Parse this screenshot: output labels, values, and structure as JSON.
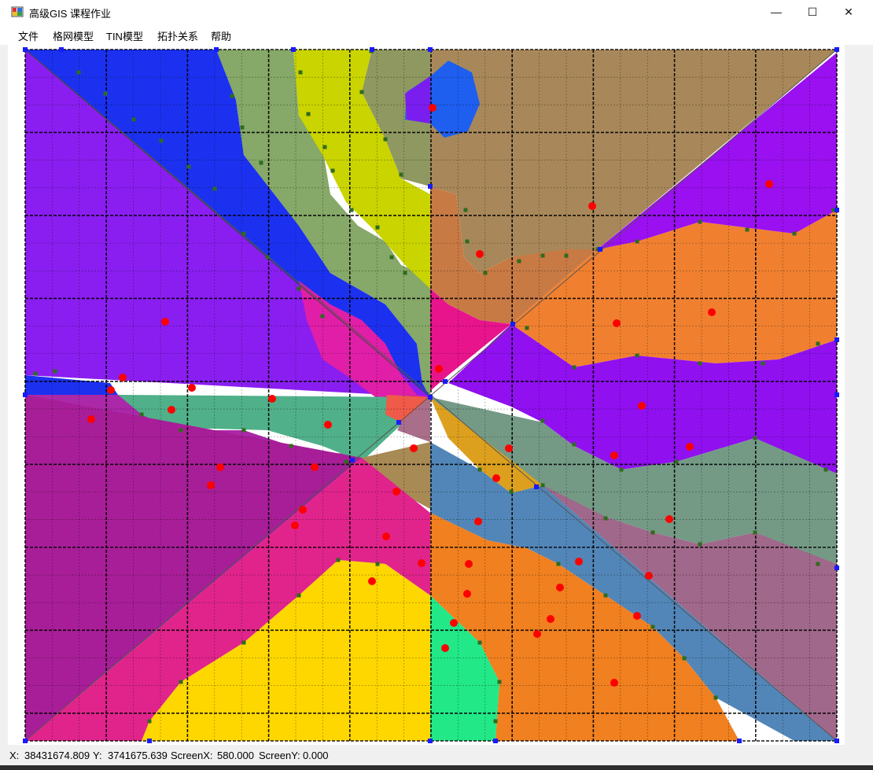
{
  "window": {
    "title": "高级GIS 课程作业",
    "minimize_glyph": "—",
    "maximize_glyph": "☐",
    "close_glyph": "✕"
  },
  "menu": [
    {
      "label": "文件"
    },
    {
      "label": "格网模型"
    },
    {
      "label": "TIN模型"
    },
    {
      "label": "拓扑关系"
    },
    {
      "label": "帮助"
    }
  ],
  "status": {
    "x_label": "X:",
    "x_value": "38431674.809",
    "y_label": "Y:",
    "y_value": "3741675.639",
    "screenx_label": "ScreenX:",
    "screenx_value": "580.000",
    "screeny_label": "ScreenY:",
    "screeny_value": "0.000"
  },
  "map": {
    "grid_columns": 30,
    "grid_rows": 25,
    "major_grid_every": 3,
    "colors": {
      "grid": "#000000",
      "sample_point": "#ff0000",
      "contour_node": "#2f6b1f",
      "tin_vertex": "#1a1aff"
    }
  }
}
